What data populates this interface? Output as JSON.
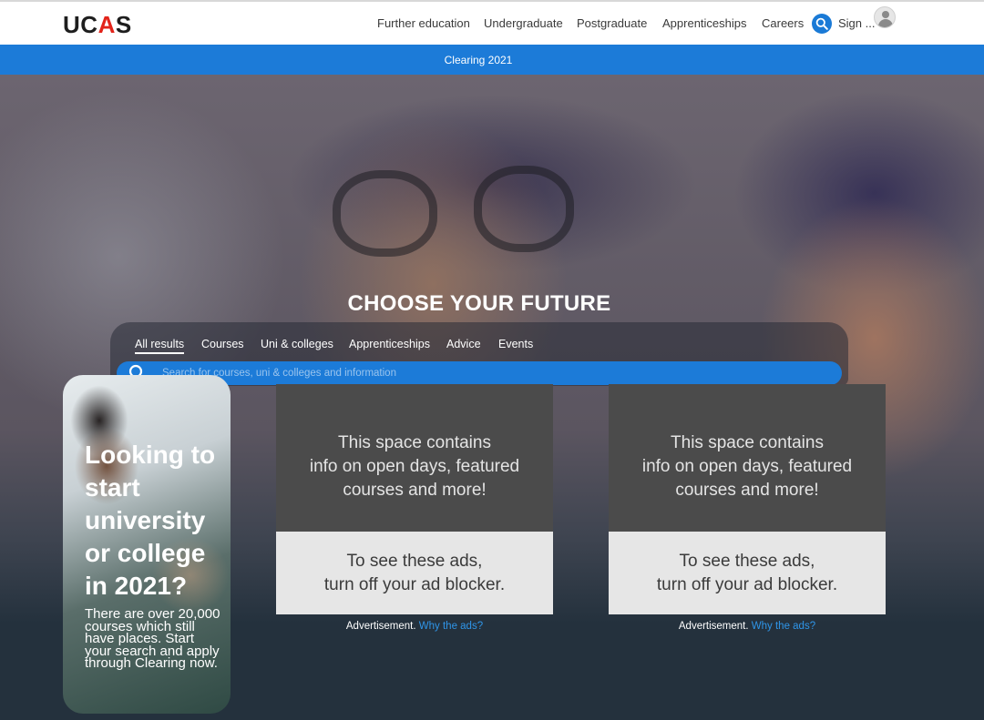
{
  "header": {
    "logo": {
      "left": "UC",
      "accent": "A",
      "right": "S"
    },
    "nav": [
      "Further education",
      "Undergraduate",
      "Postgraduate",
      "Apprenticeships",
      "Careers"
    ],
    "sign_in": "Sign ..."
  },
  "banner": {
    "label": "Clearing 2021"
  },
  "hero": {
    "title": "CHOOSE YOUR FUTURE",
    "tabs": [
      "All results",
      "Courses",
      "Uni & colleges",
      "Apprenticeships",
      "Advice",
      "Events"
    ],
    "active_tab": "All results",
    "search_placeholder": "Search for courses, uni & colleges and information"
  },
  "promo": {
    "title": "Looking to start university or college in 2021?",
    "text": "There are over 20,000 courses which still have places. Start your search and apply through Clearing now."
  },
  "ads": [
    {
      "message": "This space contains\ninfo on open days, featured\ncourses and more!",
      "blocker_message": "To see these ads,\nturn off your ad blocker.",
      "caption": "Advertisement.",
      "link": "Why the ads?"
    },
    {
      "message": "This space contains\ninfo on open days, featured\ncourses and more!",
      "blocker_message": "To see these ads,\nturn off your ad blocker.",
      "caption": "Advertisement.",
      "link": "Why the ads?"
    }
  ],
  "colors": {
    "brand_blue": "#1c7bd8",
    "logo_accent": "#e2241a",
    "link": "#2f95e8"
  }
}
